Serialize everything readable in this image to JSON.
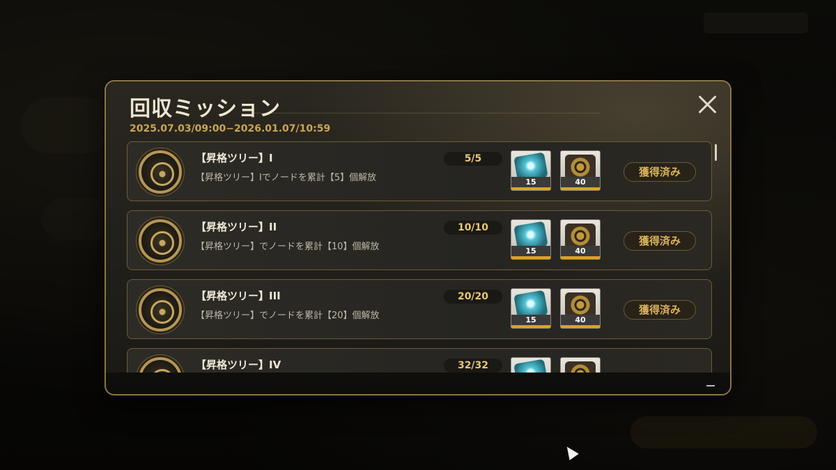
{
  "modal": {
    "title": "回収ミッション",
    "period": "2025.07.03/09:00−2026.01.07/10:59"
  },
  "missions": [
    {
      "title": "【昇格ツリー】I",
      "description": "【昇格ツリー】Iでノードを累計【5】個解放",
      "progress": "5/5",
      "rewards": [
        {
          "icon": "crystal-gem-icon",
          "qty": "15"
        },
        {
          "icon": "gold-cog-icon",
          "qty": "40"
        }
      ],
      "status_label": "獲得済み"
    },
    {
      "title": "【昇格ツリー】II",
      "description": "【昇格ツリー】でノードを累計【10】個解放",
      "progress": "10/10",
      "rewards": [
        {
          "icon": "crystal-gem-icon",
          "qty": "15"
        },
        {
          "icon": "gold-cog-icon",
          "qty": "40"
        }
      ],
      "status_label": "獲得済み"
    },
    {
      "title": "【昇格ツリー】III",
      "description": "【昇格ツリー】でノードを累計【20】個解放",
      "progress": "20/20",
      "rewards": [
        {
          "icon": "crystal-gem-icon",
          "qty": "15"
        },
        {
          "icon": "gold-cog-icon",
          "qty": "40"
        }
      ],
      "status_label": "獲得済み"
    },
    {
      "title": "【昇格ツリー】IV",
      "progress": "32/32",
      "rewards": [
        {
          "icon": "crystal-gem-icon"
        },
        {
          "icon": "gold-cog-icon"
        }
      ]
    }
  ],
  "colors": {
    "accent_gold": "#c9a555",
    "reward_bar": "#e0a21f",
    "frame": "#8a7647"
  }
}
